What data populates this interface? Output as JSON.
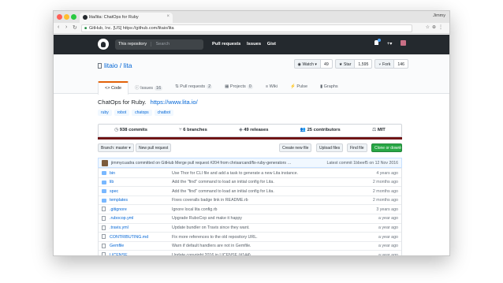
{
  "browser": {
    "tab_title": "lita/lita: ChatOps for Ruby",
    "profile": "Jimmy",
    "url": "GitHub, Inc. [US] https://github.com/litaio/lita"
  },
  "github": {
    "search_scope": "This repository",
    "search_placeholder": "Search",
    "nav": [
      "Pull requests",
      "Issues",
      "Gist"
    ],
    "plus": "+▾"
  },
  "repo": {
    "title": "litaio / lita",
    "actions": [
      {
        "label": "◉ Watch ▾",
        "count": "49"
      },
      {
        "label": "★ Star",
        "count": "1,595"
      },
      {
        "label": "⑂ Fork",
        "count": "146"
      }
    ],
    "nav": [
      {
        "label": "<> Code",
        "badge": ""
      },
      {
        "label": "ⓘ Issues",
        "badge": "16"
      },
      {
        "label": "⇅ Pull requests",
        "badge": "2"
      },
      {
        "label": "▦ Projects",
        "badge": "0"
      },
      {
        "label": "≡ Wiki",
        "badge": ""
      },
      {
        "label": "⚡ Pulse",
        "badge": ""
      },
      {
        "label": "▮ Graphs",
        "badge": ""
      }
    ],
    "description": "ChatOps for Ruby.",
    "homepage": "https://www.lita.io/",
    "topics": [
      "ruby",
      "robot",
      "chatops",
      "chatbot"
    ]
  },
  "summary": {
    "commits": "938 commits",
    "branches": "6 branches",
    "releases": "49 releases",
    "contributors": "25 contributors",
    "license": "MIT"
  },
  "language_color": "#701516",
  "file_nav": {
    "branch": "Branch: master ▾",
    "new_pr": "New pull request",
    "create": "Create new file",
    "upload": "Upload files",
    "find": "Find file",
    "clone": "Clone or download ▾"
  },
  "commit": {
    "text": "jimmycuadra committed on GitHub Merge pull request #204 from chrisarcand/fix-ruby-generators …",
    "latest": "Latest commit 1bbeef5 on 12 Nov 2016"
  },
  "files": [
    {
      "type": "dir",
      "name": "bin",
      "message": "Use Thor for CLI file and add a task to generate a new Lita instance.",
      "age": "4 years ago"
    },
    {
      "type": "dir",
      "name": "lib",
      "message": "Add the \"find\" command to load an initial config for Lita.",
      "age": "2 months ago"
    },
    {
      "type": "dir",
      "name": "spec",
      "message": "Add the \"find\" command to load an initial config for Lita.",
      "age": "2 months ago"
    },
    {
      "type": "dir",
      "name": "templates",
      "message": "Fixes coveralls badge link in README.rb",
      "age": "2 months ago"
    },
    {
      "type": "file",
      "name": ".gitignore",
      "message": "Ignore local lita config.rb",
      "age": "3 years ago"
    },
    {
      "type": "file",
      "name": ".rubocop.yml",
      "message": "Upgrade RuboCop and make it happy",
      "age": "a year ago"
    },
    {
      "type": "file",
      "name": ".travis.yml",
      "message": "Update bundler on Travis since they want.",
      "age": "a year ago"
    },
    {
      "type": "file",
      "name": "CONTRIBUTING.md",
      "message": "Fix more references to the old repository URL.",
      "age": "a year ago"
    },
    {
      "type": "file",
      "name": "Gemfile",
      "message": "Warn if default handlers are not in Gemfile.",
      "age": "a year ago"
    },
    {
      "type": "file",
      "name": "LICENSE",
      "message": "Update copyright 2016 in LICENSE (#144)",
      "age": "a year ago"
    }
  ]
}
